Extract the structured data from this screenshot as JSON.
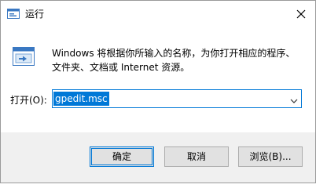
{
  "window": {
    "title": "运行",
    "close_label": "×"
  },
  "description": {
    "line1": "Windows 将根据你所输入的名称，为你打开相应的程序、",
    "line2": "文件夹、文档或 Internet 资源。"
  },
  "open_field": {
    "label": "打开(O):",
    "value": "gpedit.msc"
  },
  "buttons": {
    "ok": "确定",
    "cancel": "取消",
    "browse": "浏览(B)..."
  },
  "icons": {
    "app": "run-window-icon",
    "close": "close-icon",
    "run": "run-program-icon",
    "dropdown": "chevron-down-icon"
  },
  "colors": {
    "accent": "#0078d7",
    "footer": "#f0f0f0",
    "button": "#e1e1e1"
  }
}
